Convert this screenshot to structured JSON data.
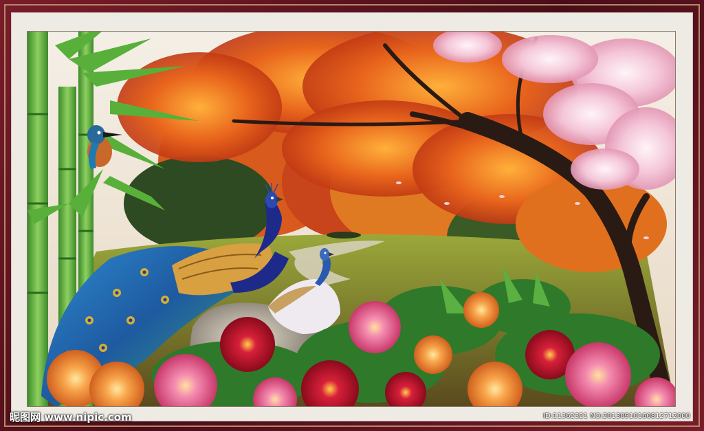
{
  "watermark": {
    "site": "昵图网 www.nipic.com",
    "id": "ID:11362321 NO:20130910160812712000"
  },
  "colors": {
    "frame": "#6a1524",
    "mat": "#eeeae4",
    "maple": "#e8641c",
    "blossom": "#f4c6d8",
    "bamboo": "#5aa83c",
    "peacock": "#1e3a9a"
  }
}
